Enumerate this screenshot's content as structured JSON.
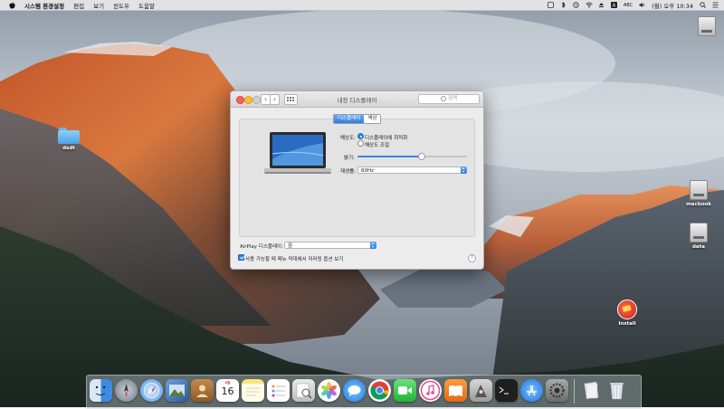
{
  "menubar": {
    "app_name": "시스템 환경설정",
    "items": [
      "편집",
      "보기",
      "윈도우",
      "도움말"
    ],
    "input_source": "ABC",
    "clock": "(월) 오후 10:34"
  },
  "desktop": {
    "icons": [
      {
        "label": "dsdt"
      },
      {
        "label": "macbook"
      },
      {
        "label": "data"
      },
      {
        "label": "Install"
      }
    ]
  },
  "window": {
    "title": "내장 디스플레이",
    "search_placeholder": "검색",
    "tabs": [
      {
        "label": "디스플레이",
        "selected": true
      },
      {
        "label": "색상",
        "selected": false
      }
    ],
    "resolution_label": "해상도:",
    "resolution_options": [
      "디스플레이에 최적화",
      "해상도 조절"
    ],
    "resolution_selected_index": 0,
    "brightness_label": "밝기:",
    "brightness_value": 0.58,
    "refresh_label": "재생률:",
    "refresh_value": "60Hz",
    "airplay_label": "AirPlay 디스플레이:",
    "airplay_value": "끔",
    "mirroring_checkbox_label": "사용 가능할 때 메뉴 막대에서 미러링 옵션 보기",
    "mirroring_checked": true,
    "help_glyph": "?"
  },
  "dock": {
    "calendar_month": "6월",
    "calendar_day": "16"
  },
  "colors": {
    "accent": "#2f7fe0",
    "close": "#fc5f57",
    "minimize": "#fdbc2e"
  }
}
